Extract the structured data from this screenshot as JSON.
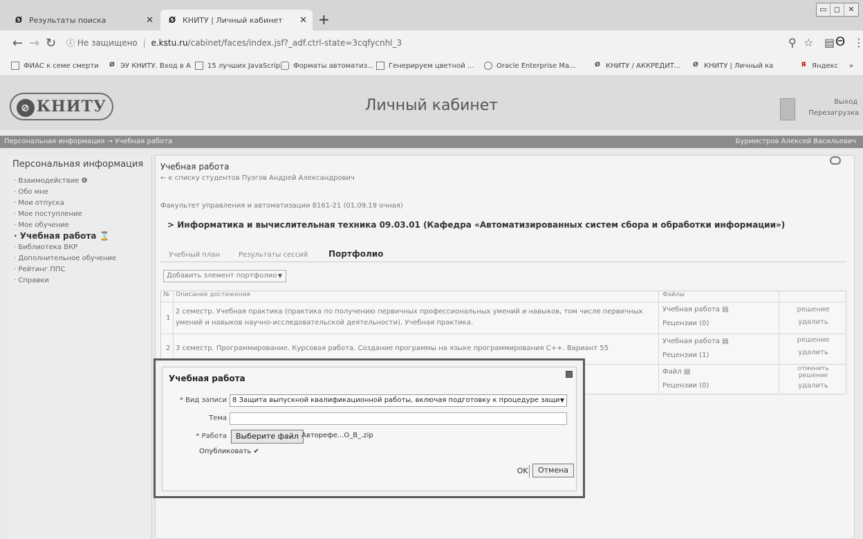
{
  "browser": {
    "tabs": [
      {
        "label": "Результаты поиска"
      },
      {
        "label": "КНИТУ | Личный кабинет"
      }
    ],
    "new_tab": "+",
    "address_secure": "Не защищено",
    "address_host": "e.kstu.ru",
    "address_path": "/cabinet/faces/index.jsf?_adf.ctrl-state=3cqfycnhl_3",
    "bookmarks": [
      "ФИАС к семе смерти",
      "ЭУ КНИТУ. Вход в А",
      "15 лучших JavaScrip.",
      "Форматы автоматиз...",
      "Генерируем цветной ...",
      "Oracle Enterprise Ma...",
      "КНИТУ / АККРЕДИТ...",
      "КНИТУ | Личный ка",
      "Яндекс",
      "»"
    ]
  },
  "site": {
    "logo": "КНИТУ",
    "title": "Личный кабинет",
    "logout": "Выход",
    "reload": "Перезагрузка",
    "breadcrumb": "Персональная информация → Учебная работа",
    "user": "Бурмистров Алексей Васильевич"
  },
  "sidebar": {
    "title": "Персональная информация",
    "items": [
      "· Взаимодействие",
      "· Обо мне",
      "· Мои отпуска",
      "· Мое поступление",
      "· Мое обучение",
      "· Учебная работа",
      "· Библиотека ВКР",
      "· Дополнительное обучение",
      "· Рейтинг ППС",
      "· Справки"
    ]
  },
  "main": {
    "title": "Учебная работа",
    "back_link": "← к списку студентов  Пуэгов Андрей Александрович",
    "faculty": "Факультет управления и автоматизации 8161-21 (01.09.19 очная)",
    "program": "> Информатика и вычислительная техника 09.03.01 (Кафедра «Автоматизированных систем сбора и обработки информации»)",
    "tabs": [
      "Учебный план",
      "Результаты сессий",
      "Портфолио"
    ],
    "add_button": "Добавить элемент портфолио",
    "table": {
      "headers": [
        "№",
        "Описание достижения",
        "Файлы"
      ],
      "rows": [
        {
          "num": "1",
          "desc": "2 семестр. Учебная практика (практика по получению первичных профессиональных умений и навыков, том числе первичных умений и навыков научно-исследовательской деятельности). Учебная практика.",
          "file1": "Учебная работа",
          "file2": "Рецензии (0)",
          "act1": "решение",
          "act2": "удалить"
        },
        {
          "num": "2",
          "desc": "3 семестр. Программирование. Курсовая работа. Создание программы на языке программирования C++. Вариант 55",
          "file1": "Учебная работа",
          "file2": "Рецензии (1)",
          "act1": "решение",
          "act2": "удалить"
        },
        {
          "num": "",
          "desc": "",
          "file1": "Файл",
          "file2": "Рецензии (0)",
          "act1": "отменить решение",
          "act2": "удалить"
        }
      ]
    }
  },
  "dialog": {
    "title": "Учебная работа",
    "kind_label": "* Вид записи",
    "kind_value": "8 Защита выпускной квалификационной работы, включая подготовку к процедуре защи",
    "topic_label": "Тема",
    "topic_value": "",
    "work_label": "* Работа",
    "file_button": "Выберите файл",
    "file_name": "Авторефе...О_В_.zip",
    "publish_label": "Опубликовать ✔",
    "ok": "OK",
    "cancel": "Отмена"
  }
}
